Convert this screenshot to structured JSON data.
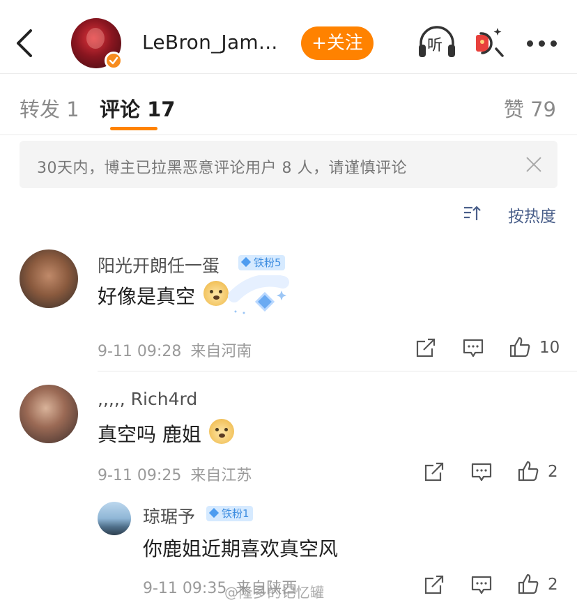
{
  "header": {
    "username": "LeBron_Jam...",
    "follow_label": "+关注",
    "listen_label": "听"
  },
  "tabs": {
    "repost": "转发 1",
    "comment": "评论 17",
    "like": "赞 79"
  },
  "notice": {
    "text": "30天内，博主已拉黑恶意评论用户 8 人，请谨慎评论"
  },
  "sort": {
    "label": "按热度"
  },
  "comments": [
    {
      "name": "阳光开朗任一蛋",
      "badge": "铁粉5",
      "text": "好像是真空",
      "emoji": "doge",
      "time": "9-11 09:28",
      "location": "来自河南",
      "likes": "10"
    },
    {
      "name": ",,,,, Rich4rd",
      "text": "真空吗 鹿姐",
      "emoji": "doge",
      "time": "9-11 09:25",
      "location": "来自江苏",
      "likes": "2"
    },
    {
      "name": "琼琚予",
      "badge": "铁粉1",
      "text": "你鹿姐近期喜欢真空风",
      "time": "9-11 09:35",
      "location": "来自陕西",
      "likes": "2"
    }
  ],
  "watermark": "@隆多的记忆罐",
  "colors": {
    "accent": "#ff8200",
    "fan_badge_bg": "#d6eaff",
    "fan_badge_text": "#3f8ee0",
    "sort_text": "#4a5f8a"
  }
}
